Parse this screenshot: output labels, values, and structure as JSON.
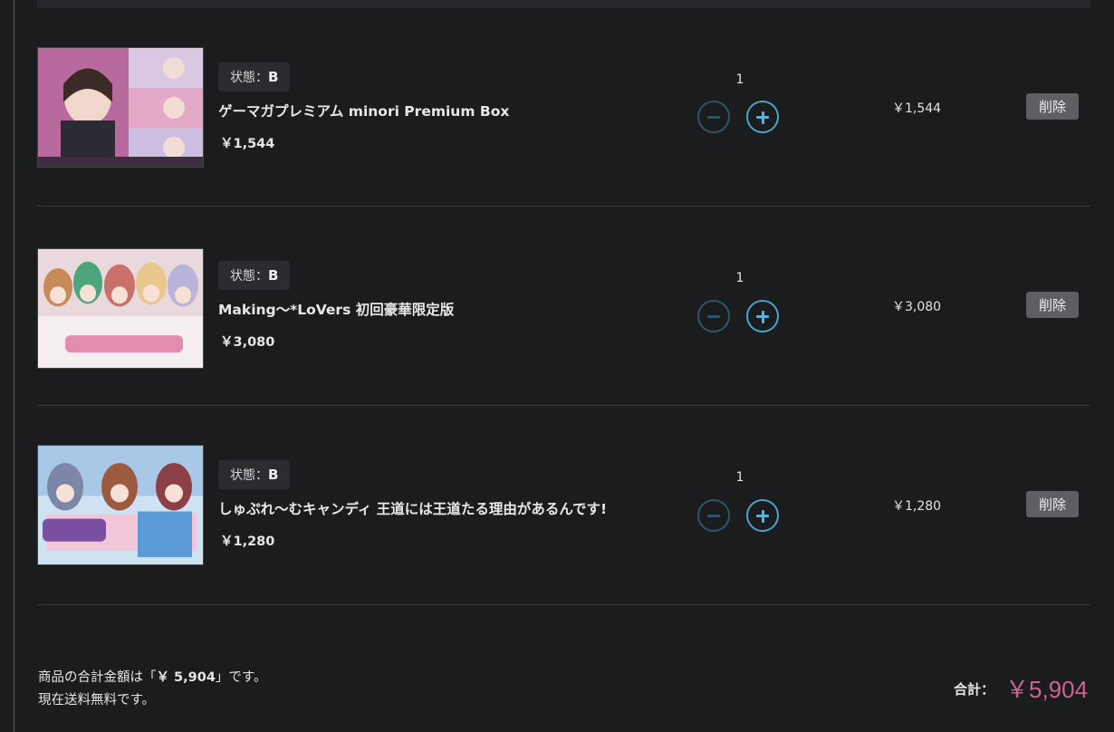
{
  "cart": {
    "items": [
      {
        "condition_label": "状態：",
        "condition": "B",
        "title": "ゲーマガプレミアム minori Premium Box",
        "price": "￥1,544",
        "quantity": "1",
        "line_total": "￥1,544",
        "delete_label": "削除",
        "image_name": "minori-premium-box-cover"
      },
      {
        "condition_label": "状態：",
        "condition": "B",
        "title": "Making～*LoVers 初回豪華限定版",
        "price": "￥3,080",
        "quantity": "1",
        "line_total": "￥3,080",
        "delete_label": "削除",
        "image_name": "making-lovers-cover"
      },
      {
        "condition_label": "状態：",
        "condition": "B",
        "title": "しゅぷれ～むキャンディ 王道には王道たる理由があるんです!",
        "price": "￥1,280",
        "quantity": "1",
        "line_total": "￥1,280",
        "delete_label": "削除",
        "image_name": "supreme-candy-cover"
      }
    ]
  },
  "summary": {
    "line1_prefix": "商品の合計金額は「",
    "line1_amount": "￥ 5,904",
    "line1_suffix": "」です。",
    "line2": "現在送料無料です。",
    "total_label": "合計：",
    "total_value": "￥5,904"
  },
  "colors": {
    "background": "#1b1c1e",
    "accent_blue": "#4ba3c9",
    "total_pink": "#d0628f",
    "delete_button": "#5e5f62"
  }
}
